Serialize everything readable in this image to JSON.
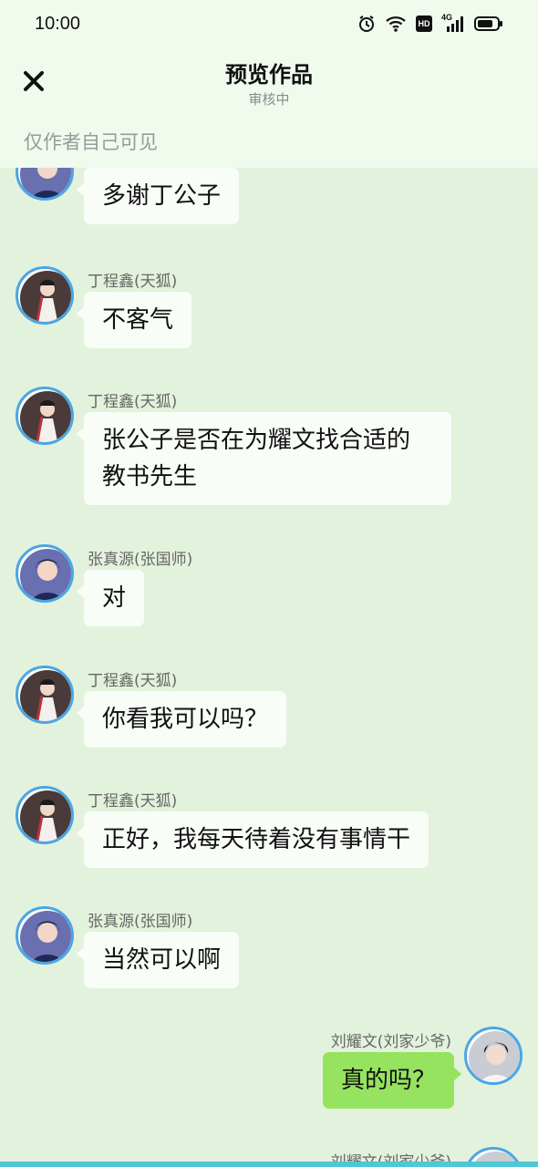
{
  "status_bar": {
    "time": "10:00",
    "icons": [
      "alarm-icon",
      "wifi-icon",
      "hd-icon",
      "signal-4g-icon",
      "battery-icon"
    ],
    "network_label": "4G",
    "hd_label": "HD"
  },
  "header": {
    "close_icon": "close-icon",
    "title": "预览作品",
    "subtitle": "审核中",
    "visibility_note": "仅作者自己可见"
  },
  "colors": {
    "background": "#e3f2dc",
    "header_bg": "#f0fbee",
    "bubble_left": "#f9fdf8",
    "bubble_right": "#95e35f",
    "avatar_border": "#4aa6e6"
  },
  "messages": [
    {
      "side": "left",
      "name": "",
      "text": "多谢丁公子",
      "avatar": "avatar-zhang"
    },
    {
      "side": "left",
      "name": "丁程鑫(天狐)",
      "text": "不客气",
      "avatar": "avatar-ding"
    },
    {
      "side": "left",
      "name": "丁程鑫(天狐)",
      "text": "张公子是否在为耀文找合适的教书先生",
      "avatar": "avatar-ding"
    },
    {
      "side": "left",
      "name": "张真源(张国师)",
      "text": "对",
      "avatar": "avatar-zhang"
    },
    {
      "side": "left",
      "name": "丁程鑫(天狐)",
      "text": "你看我可以吗？",
      "avatar": "avatar-ding"
    },
    {
      "side": "left",
      "name": "丁程鑫(天狐)",
      "text": "正好，我每天待着没有事情干",
      "avatar": "avatar-ding"
    },
    {
      "side": "left",
      "name": "张真源(张国师)",
      "text": "当然可以啊",
      "avatar": "avatar-zhang"
    },
    {
      "side": "right",
      "name": "刘耀文(刘家少爷)",
      "text": "真的吗？",
      "avatar": "avatar-liu"
    },
    {
      "side": "right",
      "name": "刘耀文(刘家少爷)",
      "text": "",
      "avatar": "avatar-liu"
    }
  ]
}
